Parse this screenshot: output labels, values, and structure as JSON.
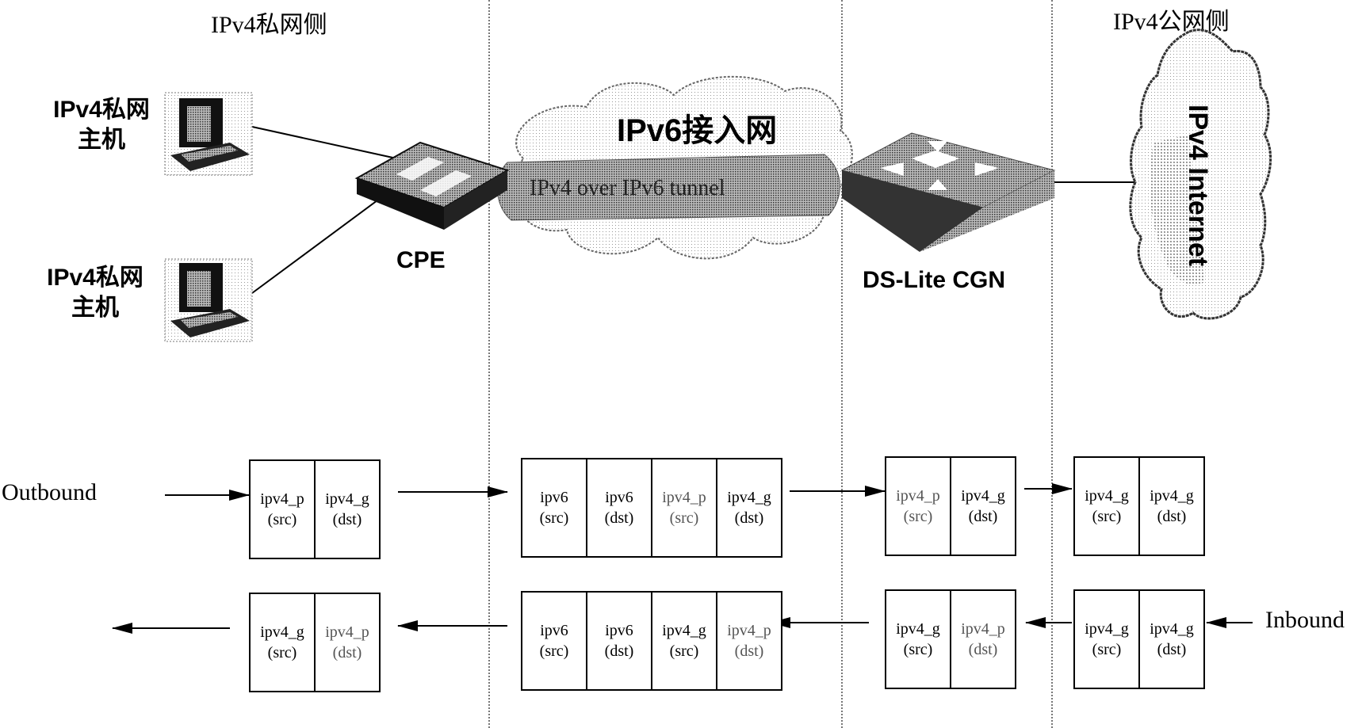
{
  "zones": {
    "private_side": "IPv4私网侧",
    "public_side": "IPv4公网侧"
  },
  "hosts": [
    {
      "line1": "IPv4私网",
      "line2": "主机"
    },
    {
      "line1": "IPv4私网",
      "line2": "主机"
    }
  ],
  "devices": {
    "cpe": "CPE",
    "cgn": "DS-Lite CGN"
  },
  "clouds": {
    "access_network": "IPv6接入网",
    "tunnel": "IPv4 over IPv6 tunnel",
    "internet": "IPv4 Internet"
  },
  "flows": {
    "outbound_label": "Outbound",
    "inbound_label": "Inbound",
    "outbound_packets": [
      {
        "fields": [
          {
            "name": "ipv4_p",
            "role": "(src)"
          },
          {
            "name": "ipv4_g",
            "role": "(dst)"
          }
        ]
      },
      {
        "fields": [
          {
            "name": "ipv6",
            "role": "(src)"
          },
          {
            "name": "ipv6",
            "role": "(dst)"
          },
          {
            "name": "ipv4_p",
            "role": "(src)"
          },
          {
            "name": "ipv4_g",
            "role": "(dst)"
          }
        ]
      },
      {
        "fields": [
          {
            "name": "ipv4_p",
            "role": "(src)"
          },
          {
            "name": "ipv4_g",
            "role": "(dst)"
          }
        ]
      },
      {
        "fields": [
          {
            "name": "ipv4_g",
            "role": "(src)"
          },
          {
            "name": "ipv4_g",
            "role": "(dst)"
          }
        ]
      }
    ],
    "inbound_packets": [
      {
        "fields": [
          {
            "name": "ipv4_g",
            "role": "(src)"
          },
          {
            "name": "ipv4_p",
            "role": "(dst)"
          }
        ]
      },
      {
        "fields": [
          {
            "name": "ipv6",
            "role": "(src)"
          },
          {
            "name": "ipv6",
            "role": "(dst)"
          },
          {
            "name": "ipv4_g",
            "role": "(src)"
          },
          {
            "name": "ipv4_p",
            "role": "(dst)"
          }
        ]
      },
      {
        "fields": [
          {
            "name": "ipv4_g",
            "role": "(src)"
          },
          {
            "name": "ipv4_p",
            "role": "(dst)"
          }
        ]
      },
      {
        "fields": [
          {
            "name": "ipv4_g",
            "role": "(src)"
          },
          {
            "name": "ipv4_g",
            "role": "(dst)"
          }
        ]
      }
    ]
  }
}
